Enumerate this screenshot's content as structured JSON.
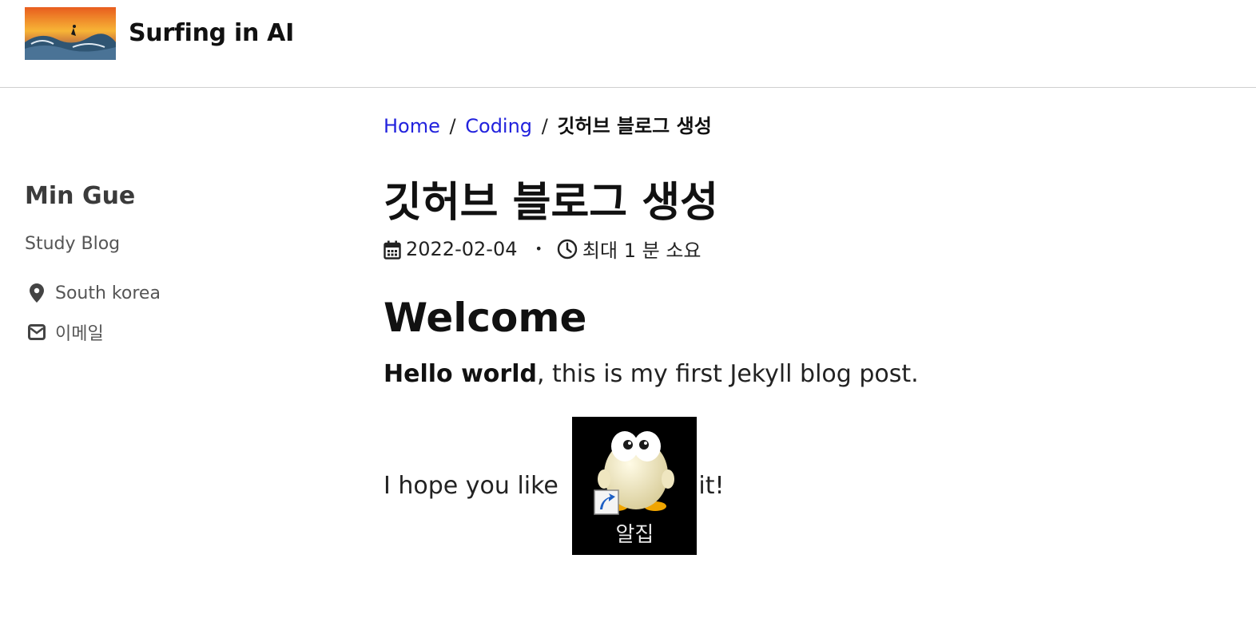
{
  "site": {
    "title": "Surfing in AI",
    "logo_icon": "surfer-photo-icon"
  },
  "breadcrumb": {
    "home": "Home",
    "sep": "/",
    "category": "Coding",
    "current": "깃허브 블로그 생성"
  },
  "author": {
    "name": "Min Gue",
    "bio": "Study Blog",
    "location": "South korea",
    "email_label": "이메일"
  },
  "post": {
    "title": "깃허브 블로그 생성",
    "date": "2022-02-04",
    "meta_sep": "•",
    "read_time": "최대 1 분 소요",
    "heading": "Welcome",
    "p1_bold": "Hello world",
    "p1_rest": ", this is my first Jekyll blog post.",
    "p2_before": "I hope you like ",
    "p2_after": "it!",
    "image_label": "알집"
  },
  "colors": {
    "link": "#2222dd",
    "text": "#222222",
    "sidebar_text": "#555555"
  }
}
